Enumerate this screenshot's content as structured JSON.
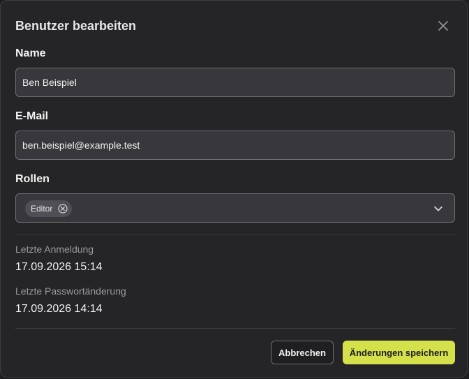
{
  "dialog": {
    "title": "Benutzer bearbeiten",
    "close_icon": "close-icon"
  },
  "form": {
    "name_label": "Name",
    "name_value": "Ben Beispiel",
    "email_label": "E-Mail",
    "email_value": "ben.beispiel@example.test",
    "roles_label": "Rollen",
    "roles_selected": [
      "Editor"
    ],
    "chip_remove_icon": "circle-x-icon",
    "dropdown_icon": "chevron-down-icon"
  },
  "meta": {
    "last_login_label": "Letzte Anmeldung",
    "last_login_value": "17.09.2026 15:14",
    "last_password_change_label": "Letzte Passwortänderung",
    "last_password_change_value": "17.09.2026 14:14"
  },
  "actions": {
    "cancel_label": "Abbrechen",
    "save_label": "Änderungen speichern"
  },
  "colors": {
    "accent": "#d4e14a",
    "surface": "#252527",
    "input_bg": "#38383c"
  }
}
